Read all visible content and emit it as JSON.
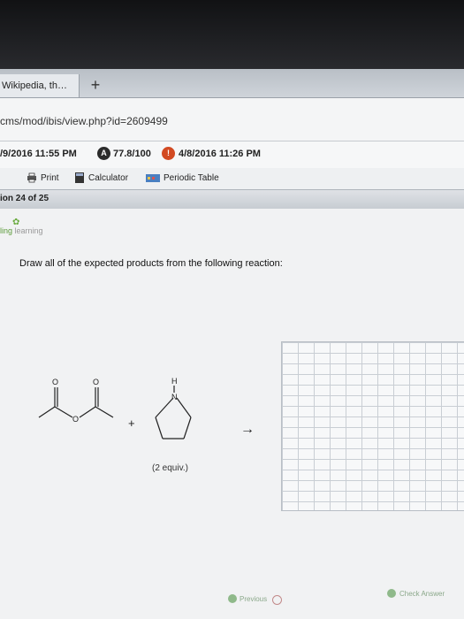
{
  "browser": {
    "tab_title": "Wikipedia, th…",
    "new_tab_symbol": "+",
    "url": "cms/mod/ibis/view.php?id=2609499"
  },
  "info": {
    "start_time": "/9/2016 11:55 PM",
    "score_badge": "A",
    "score": "77.8/100",
    "due_badge": "!",
    "due_time": "4/8/2016 11:26 PM"
  },
  "toolbar": {
    "print_label": "Print",
    "calculator_label": "Calculator",
    "periodic_table_label": "Periodic Table"
  },
  "question": {
    "nav_label": "ion 24 of 25",
    "logo_text_1": "ling",
    "logo_text_2": "learning",
    "prompt": "Draw all of the expected products from the following reaction:",
    "equiv_note": "(2 equiv.)",
    "atom_o1": "O",
    "atom_o2": "O",
    "atom_o3": "O",
    "atom_h": "H",
    "atom_n": "N",
    "plus": "+",
    "arrow": "→"
  },
  "footer": {
    "previous_label": "Previous",
    "check_answer_label": "Check Answer"
  },
  "colors": {
    "score_badge": "#2b2b2b",
    "due_badge": "#d24a22",
    "logo_green": "#5c9b3a"
  }
}
